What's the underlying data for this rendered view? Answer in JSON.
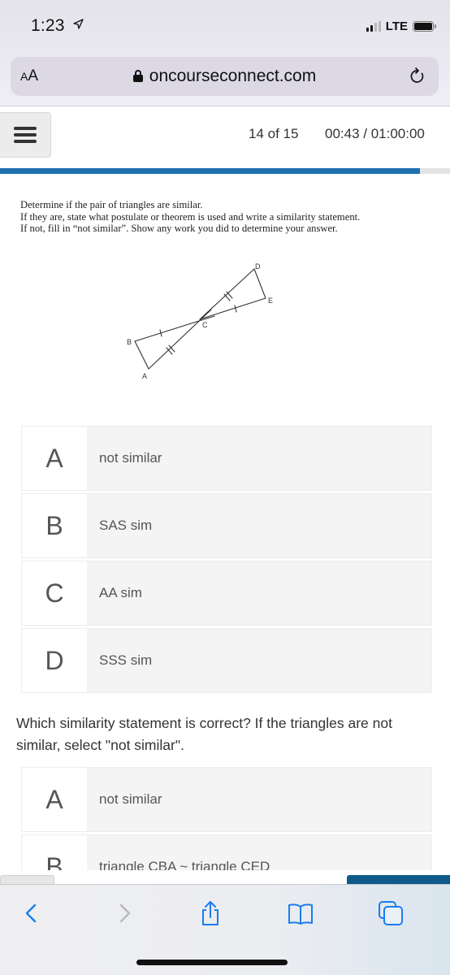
{
  "status_bar": {
    "time": "1:23",
    "location_icon": "location-arrow-icon",
    "network": "LTE",
    "signal_bars_active": 2,
    "signal_bars_total": 4,
    "battery_level_percent": 100
  },
  "browser": {
    "text_size_label_small": "A",
    "text_size_label_large": "A",
    "url": "oncourseconnect.com",
    "secure_icon": "lock-icon",
    "reload_icon": "reload-icon"
  },
  "header": {
    "menu_icon": "hamburger-icon",
    "question_counter": "14 of 15",
    "timer": "00:43 / 01:00:00",
    "progress_fraction": 0.9333,
    "progress_color": "#1f6fae"
  },
  "question1": {
    "instructions": [
      "Determine if the pair of triangles are similar.",
      "If they are, state what postulate or theorem is used and write a similarity statement.",
      "If not, fill in “not similar”.  Show any work you did to determine your answer."
    ],
    "figure_labels": [
      "A",
      "B",
      "C",
      "D",
      "E"
    ],
    "options": [
      {
        "letter": "A",
        "text": "not similar"
      },
      {
        "letter": "B",
        "text": "SAS sim"
      },
      {
        "letter": "C",
        "text": "AA sim"
      },
      {
        "letter": "D",
        "text": "SSS sim"
      }
    ]
  },
  "question2": {
    "prompt": "Which similarity statement is correct?  If the triangles are not similar, select \"not similar\".",
    "options": [
      {
        "letter": "A",
        "text": "not similar"
      },
      {
        "letter": "B",
        "text": "triangle CBA ~ triangle CED"
      }
    ]
  },
  "toolbar": {
    "back_icon": "chevron-left-icon",
    "forward_icon": "chevron-right-icon",
    "share_icon": "share-icon",
    "bookmarks_icon": "book-icon",
    "tabs_icon": "tabs-icon",
    "accent_color": "#1a7cf0"
  }
}
